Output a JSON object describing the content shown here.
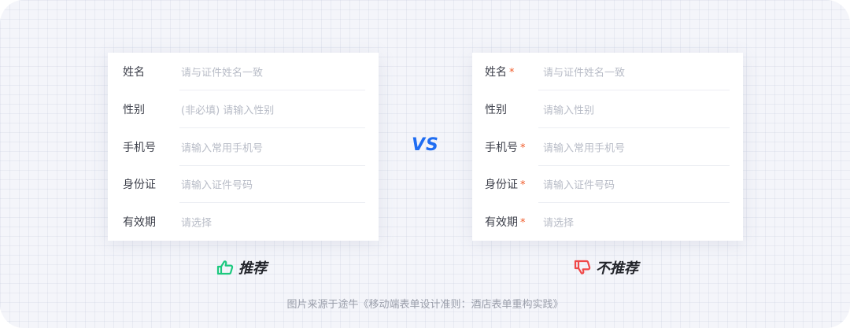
{
  "vs_label": "VS",
  "left_form": {
    "rows": [
      {
        "label": "姓名",
        "placeholder": "请与证件姓名一致"
      },
      {
        "label": "性别",
        "placeholder": "(非必填) 请输入性别"
      },
      {
        "label": "手机号",
        "placeholder": "请输入常用手机号"
      },
      {
        "label": "身份证",
        "placeholder": "请输入证件号码"
      },
      {
        "label": "有效期",
        "placeholder": "请选择"
      }
    ]
  },
  "right_form": {
    "required_mark": "*",
    "rows": [
      {
        "label": "姓名",
        "placeholder": "请与证件姓名一致",
        "required": true
      },
      {
        "label": "性别",
        "placeholder": "请输入性别",
        "required": false
      },
      {
        "label": "手机号",
        "placeholder": "请输入常用手机号",
        "required": true
      },
      {
        "label": "身份证",
        "placeholder": "请输入证件号码",
        "required": true
      },
      {
        "label": "有效期",
        "placeholder": "请选择",
        "required": true
      }
    ]
  },
  "verdicts": {
    "recommended": {
      "label": "推荐",
      "icon": "thumbs-up-icon",
      "color": "#1dc97f"
    },
    "not_recommended": {
      "label": "不推荐",
      "icon": "thumbs-down-icon",
      "color": "#f04848"
    }
  },
  "caption": "图片来源于途牛《移动端表单设计准则：酒店表单重构实践》",
  "colors": {
    "accent_vs": "#1f6df2",
    "required_star": "#f05a28",
    "label_text": "#3c3f4a",
    "placeholder_text": "#b8bcc7"
  }
}
